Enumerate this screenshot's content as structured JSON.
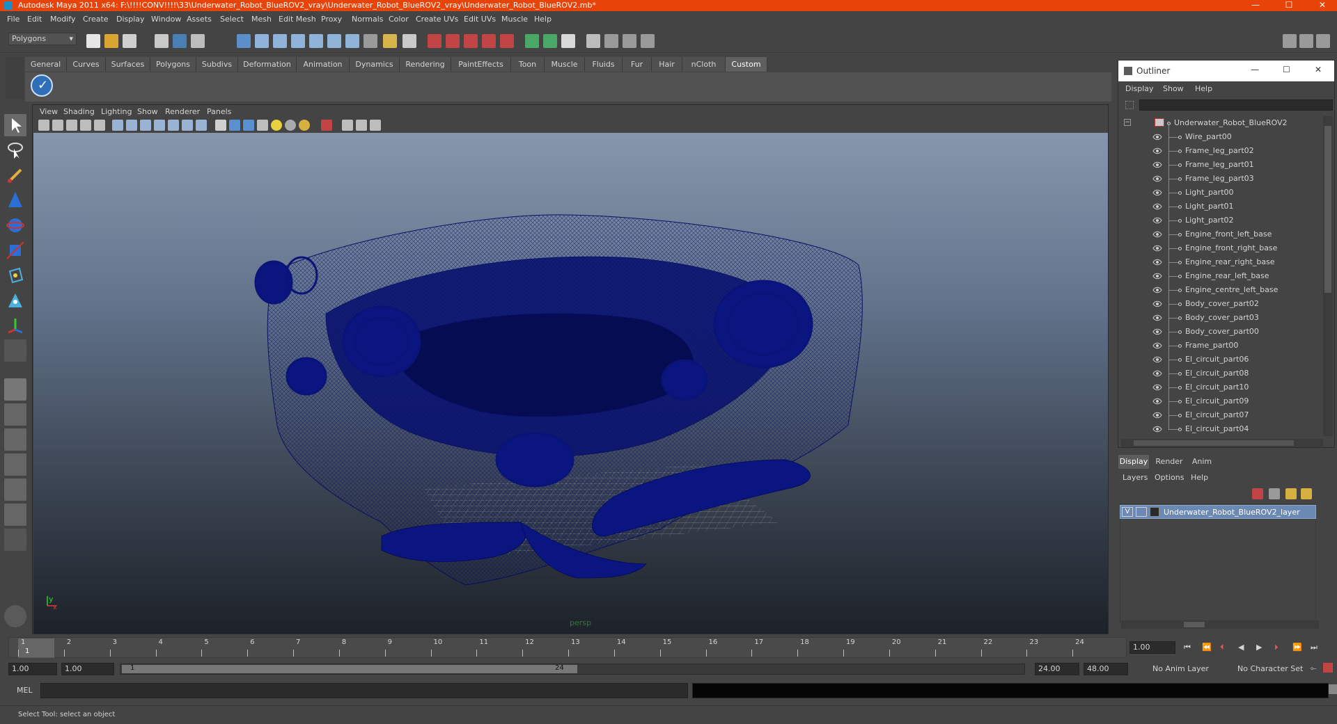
{
  "window": {
    "title": "Autodesk Maya 2011 x64: F:\\!!!!CONV!!!!\\33\\Underwater_Robot_BlueROV2_vray\\Underwater_Robot_BlueROV2_vray\\Underwater_Robot_BlueROV2.mb*",
    "minimize": "—",
    "maximize": "☐",
    "close": "✕"
  },
  "menubar": [
    "File",
    "Edit",
    "Modify",
    "Create",
    "Display",
    "Window",
    "Assets",
    "Select",
    "Mesh",
    "Edit Mesh",
    "Proxy",
    "Normals",
    "Color",
    "Create UVs",
    "Edit UVs",
    "Muscle",
    "Help"
  ],
  "statusline": {
    "menuset": "Polygons"
  },
  "shelf": {
    "tabs": [
      "General",
      "Curves",
      "Surfaces",
      "Polygons",
      "Subdivs",
      "Deformation",
      "Animation",
      "Dynamics",
      "Rendering",
      "PaintEffects",
      "Toon",
      "Muscle",
      "Fluids",
      "Fur",
      "Hair",
      "nCloth",
      "Custom"
    ],
    "active_tab": "Custom"
  },
  "viewport": {
    "menu": [
      "View",
      "Shading",
      "Lighting",
      "Show",
      "Renderer",
      "Panels"
    ],
    "camera_label": "persp",
    "axis_y": "y",
    "axis_x": "x"
  },
  "timeline": {
    "ticks": [
      "1",
      "2",
      "3",
      "4",
      "5",
      "6",
      "7",
      "8",
      "9",
      "10",
      "11",
      "12",
      "13",
      "14",
      "15",
      "16",
      "17",
      "18",
      "19",
      "20",
      "21",
      "22",
      "23",
      "24"
    ],
    "current_frame_marker": "1",
    "current_time": "1.00"
  },
  "range": {
    "start_time": "1.00",
    "playback_start": "1.00",
    "slider_start": "1",
    "slider_end": "24",
    "playback_end": "24.00",
    "end_time": "48.00",
    "anim_layer": "No Anim Layer",
    "character_set": "No Character Set"
  },
  "command": {
    "language": "MEL"
  },
  "helpline": {
    "text": "Select Tool: select an object"
  },
  "outliner": {
    "title": "Outliner",
    "menu": [
      "Display",
      "Show",
      "Help"
    ],
    "root": "Underwater_Robot_BlueROV2",
    "items": [
      "Wire_part00",
      "Frame_leg_part02",
      "Frame_leg_part01",
      "Frame_leg_part03",
      "Light_part00",
      "Light_part01",
      "Light_part02",
      "Engine_front_left_base",
      "Engine_front_right_base",
      "Engine_rear_right_base",
      "Engine_rear_left_base",
      "Engine_centre_left_base",
      "Body_cover_part02",
      "Body_cover_part03",
      "Body_cover_part00",
      "Frame_part00",
      "El_circuit_part06",
      "El_circuit_part08",
      "El_circuit_part10",
      "El_circuit_part09",
      "El_circuit_part07",
      "El_circuit_part04"
    ]
  },
  "layer_editor": {
    "tabs": [
      "Display",
      "Render",
      "Anim"
    ],
    "active_tab": "Display",
    "menu": [
      "Layers",
      "Options",
      "Help"
    ],
    "layers": [
      {
        "visible": "V",
        "name": "Underwater_Robot_BlueROV2_layer"
      }
    ]
  },
  "colors": {
    "titlebar": "#e8440a",
    "panel": "#444444",
    "wireframe": "#0a1378",
    "selection": "#6b89b3"
  }
}
